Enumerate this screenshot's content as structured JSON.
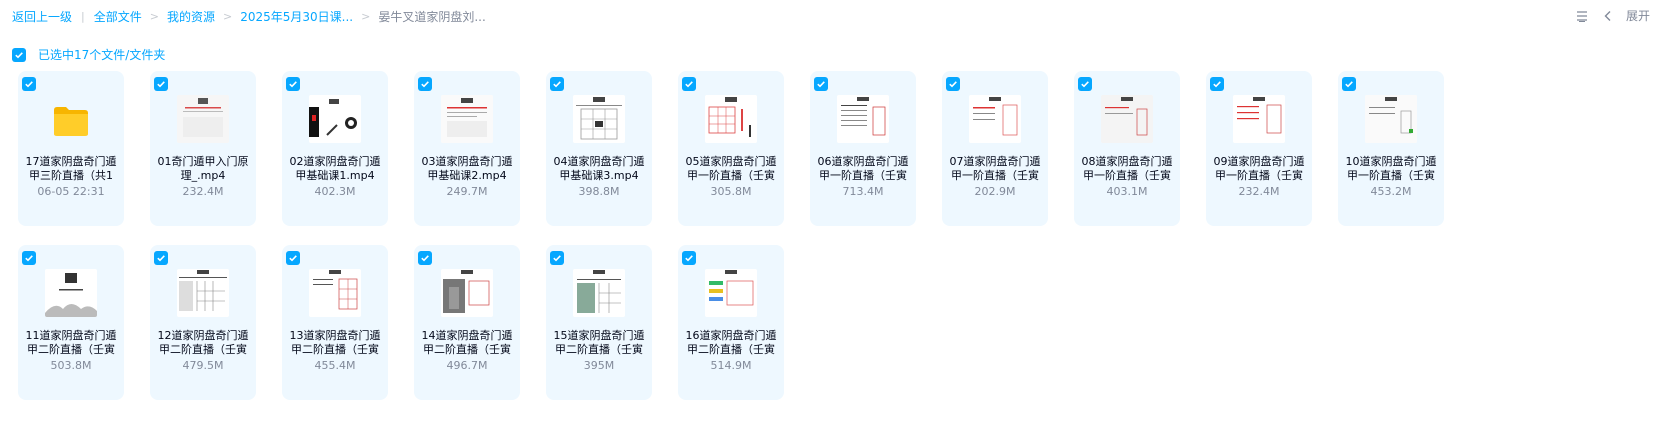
{
  "breadcrumb": {
    "back": "返回上一级",
    "items": [
      "全部文件",
      "我的资源",
      "2025年5月30日课...",
      "晏牛叉道家阴盘刘..."
    ]
  },
  "header": {
    "expand_label": "展开"
  },
  "selection": {
    "label": "已选中17个文件/文件夹"
  },
  "colors": {
    "accent": "#06a7ff",
    "card_bg": "#eef8ff",
    "muted": "#818999"
  },
  "files": [
    {
      "name": "17道家阴盘奇门遁甲三阶直播（共1",
      "meta": "06-05 22:31",
      "type": "folder",
      "icon": "folder-icon"
    },
    {
      "name": "01奇门遁甲入门原理_.mp4",
      "meta": "232.4M",
      "type": "video",
      "icon": "video-thumbnail"
    },
    {
      "name": "02道家阴盘奇门遁甲基础课1.mp4",
      "meta": "402.3M",
      "type": "video",
      "icon": "video-thumbnail"
    },
    {
      "name": "03道家阴盘奇门遁甲基础课2.mp4",
      "meta": "249.7M",
      "type": "video",
      "icon": "video-thumbnail"
    },
    {
      "name": "04道家阴盘奇门遁甲基础课3.mp4",
      "meta": "398.8M",
      "type": "video",
      "icon": "video-thumbnail"
    },
    {
      "name": "05道家阴盘奇门遁甲一阶直播（壬寅",
      "meta": "305.8M",
      "type": "video",
      "icon": "video-thumbnail"
    },
    {
      "name": "06道家阴盘奇门遁甲一阶直播（壬寅",
      "meta": "713.4M",
      "type": "video",
      "icon": "video-thumbnail"
    },
    {
      "name": "07道家阴盘奇门遁甲一阶直播（壬寅",
      "meta": "202.9M",
      "type": "video",
      "icon": "video-thumbnail"
    },
    {
      "name": "08道家阴盘奇门遁甲一阶直播（壬寅",
      "meta": "403.1M",
      "type": "video",
      "icon": "video-thumbnail"
    },
    {
      "name": "09道家阴盘奇门遁甲一阶直播（壬寅",
      "meta": "232.4M",
      "type": "video",
      "icon": "video-thumbnail"
    },
    {
      "name": "10道家阴盘奇门遁甲一阶直播（壬寅",
      "meta": "453.2M",
      "type": "video",
      "icon": "video-thumbnail"
    },
    {
      "name": "11道家阴盘奇门遁甲二阶直播（壬寅",
      "meta": "503.8M",
      "type": "video",
      "icon": "video-thumbnail"
    },
    {
      "name": "12道家阴盘奇门遁甲二阶直播（壬寅",
      "meta": "479.5M",
      "type": "video",
      "icon": "video-thumbnail"
    },
    {
      "name": "13道家阴盘奇门遁甲二阶直播（壬寅",
      "meta": "455.4M",
      "type": "video",
      "icon": "video-thumbnail"
    },
    {
      "name": "14道家阴盘奇门遁甲二阶直播（壬寅",
      "meta": "496.7M",
      "type": "video",
      "icon": "video-thumbnail"
    },
    {
      "name": "15道家阴盘奇门遁甲二阶直播（壬寅",
      "meta": "395M",
      "type": "video",
      "icon": "video-thumbnail"
    },
    {
      "name": "16道家阴盘奇门遁甲二阶直播（壬寅",
      "meta": "514.9M",
      "type": "video",
      "icon": "video-thumbnail"
    }
  ]
}
